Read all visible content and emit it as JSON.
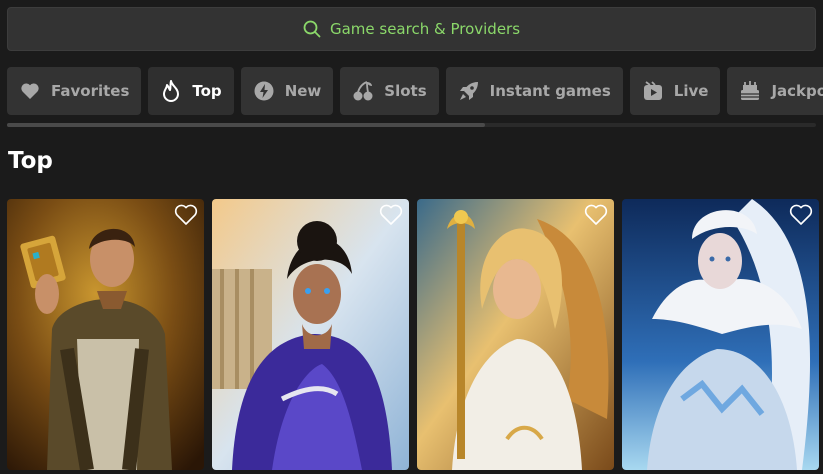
{
  "search": {
    "label": "Game search & Providers"
  },
  "categories": [
    {
      "label": "Favorites",
      "icon": "heart-icon"
    },
    {
      "label": "Top",
      "icon": "flame-icon",
      "active": true
    },
    {
      "label": "New",
      "icon": "lightning-icon"
    },
    {
      "label": "Slots",
      "icon": "cherries-icon"
    },
    {
      "label": "Instant games",
      "icon": "rocket-icon"
    },
    {
      "label": "Live",
      "icon": "live-video-icon"
    },
    {
      "label": "Jackpots",
      "icon": "cake-icon"
    }
  ],
  "section": {
    "title": "Top"
  },
  "games": [
    {
      "icon": "favorite-heart-icon"
    },
    {
      "icon": "favorite-heart-icon"
    },
    {
      "icon": "favorite-heart-icon"
    },
    {
      "icon": "favorite-heart-icon"
    }
  ],
  "colors": {
    "accent": "#8bd86a",
    "background": "#1b1b1b",
    "tile": "#333333"
  }
}
